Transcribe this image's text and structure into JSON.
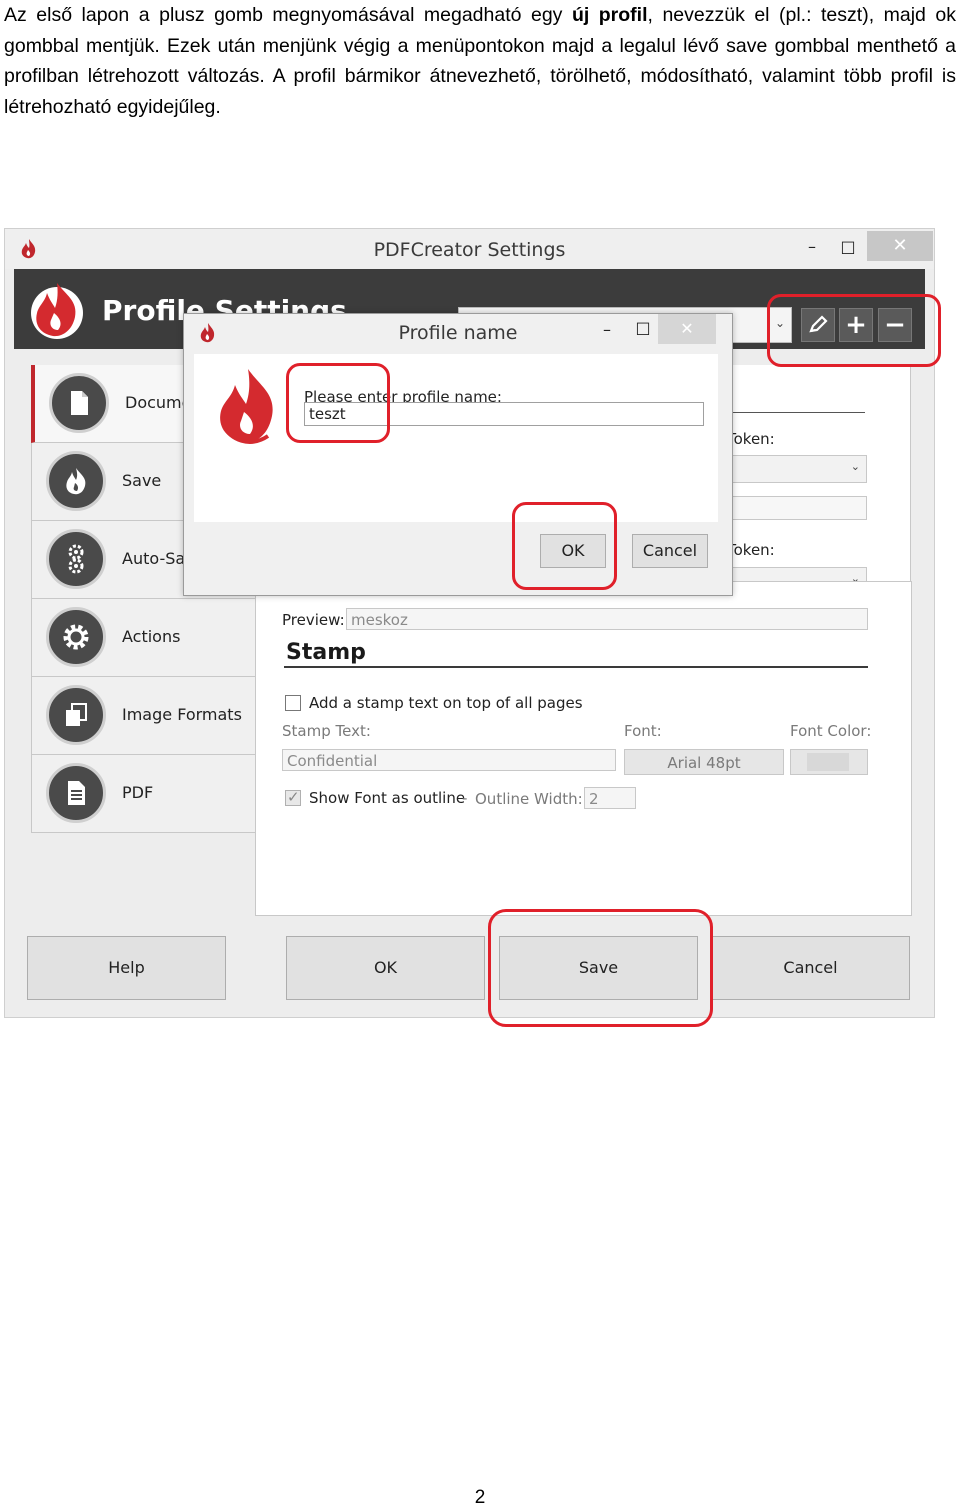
{
  "document": {
    "intro_part1": "Az első lapon a plusz gomb megnyomásával megadható egy ",
    "intro_bold": "új profil",
    "intro_part2": ", nevezzük el (pl.: teszt), majd ok gombbal mentjük. Ezek után menjünk végig a menüpontokon majd a legalul lévő save gombbal menthető a profilban létrehozott változás. A profil bármikor átnevezhető, törölhető, módosítható, valamint több profil is létrehozható egyidejűleg.",
    "page_number": "2"
  },
  "window": {
    "title": "PDFCreator Settings",
    "minimize": "–",
    "maximize": "□",
    "close": "✕"
  },
  "header": {
    "title": "Profile Settings",
    "combo_arrow": "⌄",
    "rename_icon": "pencil-icon",
    "add_label": "+",
    "remove_label": "−"
  },
  "sidebar": {
    "items": [
      {
        "label": "Document",
        "icon": "document-icon"
      },
      {
        "label": "Save",
        "icon": "flame-icon"
      },
      {
        "label": "Auto-Save",
        "icon": "gears-icon"
      },
      {
        "label": "Actions",
        "icon": "gear-icon"
      },
      {
        "label": "Image Formats",
        "icon": "images-icon"
      },
      {
        "label": "PDF",
        "icon": "pdf-icon"
      }
    ]
  },
  "right_panel": {
    "token1_label": "Token:",
    "token2_label": "Token:"
  },
  "main": {
    "preview_label": "Preview:",
    "preview_value": "meskoz",
    "stamp_title": "Stamp",
    "add_stamp_label": "Add a stamp text on top of all pages",
    "add_stamp_checked": false,
    "stamp_text_label": "Stamp Text:",
    "stamp_text_value": "Confidential",
    "font_label": "Font:",
    "font_value": "Arial 48pt",
    "font_color_label": "Font Color:",
    "font_color": "#d8d8d8",
    "outline_label": "Show Font as outline",
    "outline_checked": true,
    "outline_sep": "-",
    "outline_width_label": "Outline Width:",
    "outline_width_value": "2"
  },
  "buttons": {
    "help": "Help",
    "ok": "OK",
    "save": "Save",
    "cancel": "Cancel"
  },
  "dialog": {
    "title": "Profile name",
    "minimize": "–",
    "maximize": "□",
    "close": "✕",
    "prompt": "Please enter profile name:",
    "input_value": "teszt",
    "ok": "OK",
    "cancel": "Cancel"
  },
  "colors": {
    "highlight": "#e0202a",
    "brand_red": "#c0272d",
    "header_bg": "#3c3c3c"
  }
}
